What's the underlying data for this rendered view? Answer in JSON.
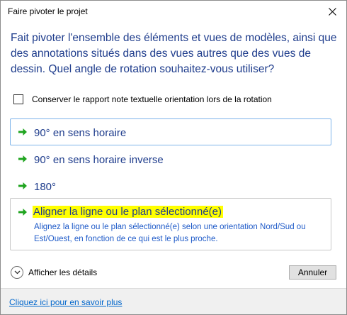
{
  "window": {
    "title": "Faire pivoter le projet",
    "close_glyph": "✕"
  },
  "instruction": "Fait pivoter l'ensemble des éléments et vues de modèles, ainsi que des annotations situés dans des vues autres que des vues de dessin. Quel angle de rotation souhaitez-vous utiliser?",
  "checkbox": {
    "label": "Conserver le rapport note textuelle orientation lors de la rotation",
    "checked": false
  },
  "commands": [
    {
      "label": "90° en sens horaire",
      "icon": "green-arrow-icon"
    },
    {
      "label": "90° en sens horaire inverse",
      "icon": "green-arrow-icon"
    },
    {
      "label": "180°",
      "icon": "green-arrow-icon"
    },
    {
      "label": "Aligner la ligne ou le plan sélectionné(e)",
      "icon": "green-arrow-icon",
      "description": "Alignez la ligne ou le plan sélectionné(e) selon une orientation Nord/Sud ou Est/Ouest, en fonction de ce qui est le plus proche."
    }
  ],
  "details": {
    "label": "Afficher les détails",
    "icon": "chevron-down-icon"
  },
  "cancel_label": "Annuler",
  "footer_link": "Cliquez ici pour en savoir plus",
  "colors": {
    "instruction_text": "#1e3c8c",
    "arrow_green": "#1fa41f",
    "highlight": "#ffff00",
    "link": "#0066cc",
    "hover_border": "#7eb4ea"
  }
}
